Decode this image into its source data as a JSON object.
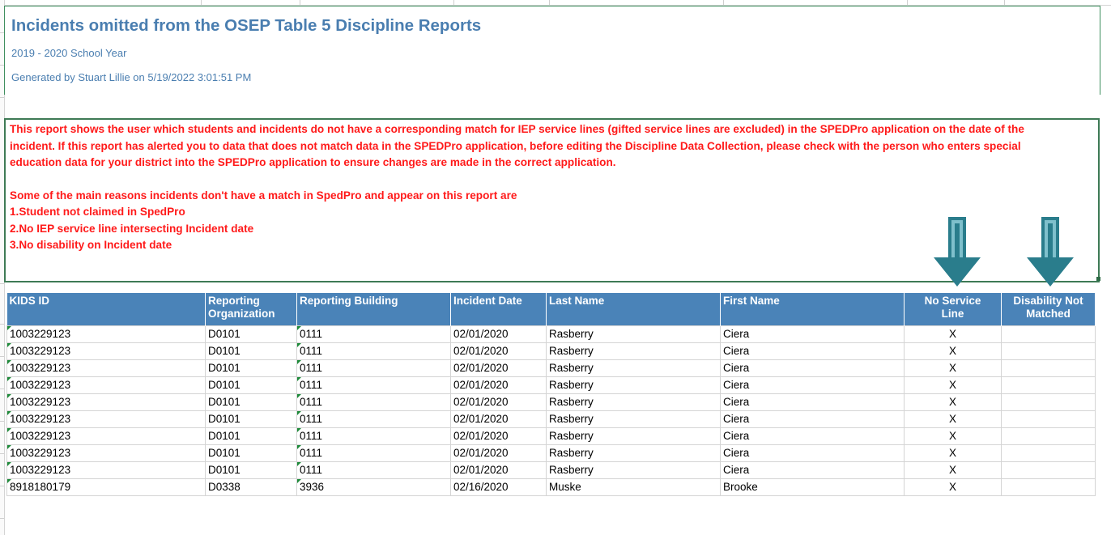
{
  "report": {
    "title": "Incidents omitted from the OSEP Table 5 Discipline Reports",
    "school_year": "2019 - 2020 School Year",
    "generated_by": "Generated by Stuart Lillie on 5/19/2022 3:01:51 PM"
  },
  "notice": {
    "paragraph": "This report shows the user which students and incidents do not have a corresponding match for IEP service lines (gifted service lines are excluded) in the SPEDPro application on the date of the incident. If this report has alerted you to data that does not match data in the SPEDPro application, before editing the Discipline Data Collection, please check with the person who enters special education data for your district into the SPEDPro application to ensure changes are made in the correct application.",
    "reasons_intro": "Some of the main reasons incidents don't have a match in SpedPro and appear on this report are",
    "reasons": [
      "1.Student not claimed in SpedPro",
      "2.No IEP service line intersecting Incident date",
      "3.No disability on Incident date"
    ]
  },
  "colors": {
    "title": "#4a7eb0",
    "notice_text": "#ff1a1a",
    "header_bg": "#4a83b8",
    "arrow": "#2a7d8c",
    "cell_flag": "#1e8a3a"
  },
  "table": {
    "headers": {
      "kids_id": "KIDS ID",
      "reporting_org_line1": "Reporting",
      "reporting_org_line2": "Organization",
      "reporting_building": "Reporting Building",
      "incident_date": "Incident Date",
      "last_name": "Last Name",
      "first_name": "First Name",
      "no_service_line1": "No Service",
      "no_service_line2": "Line",
      "disability_line1": "Disability Not",
      "disability_line2": "Matched"
    },
    "rows": [
      {
        "kids_id": "1003229123",
        "org": "D0101",
        "building": "0111",
        "date": "02/01/2020",
        "last": "Rasberry",
        "first": "Ciera",
        "no_service": "X",
        "disability": ""
      },
      {
        "kids_id": "1003229123",
        "org": "D0101",
        "building": "0111",
        "date": "02/01/2020",
        "last": "Rasberry",
        "first": "Ciera",
        "no_service": "X",
        "disability": ""
      },
      {
        "kids_id": "1003229123",
        "org": "D0101",
        "building": "0111",
        "date": "02/01/2020",
        "last": "Rasberry",
        "first": "Ciera",
        "no_service": "X",
        "disability": ""
      },
      {
        "kids_id": "1003229123",
        "org": "D0101",
        "building": "0111",
        "date": "02/01/2020",
        "last": "Rasberry",
        "first": "Ciera",
        "no_service": "X",
        "disability": ""
      },
      {
        "kids_id": "1003229123",
        "org": "D0101",
        "building": "0111",
        "date": "02/01/2020",
        "last": "Rasberry",
        "first": "Ciera",
        "no_service": "X",
        "disability": ""
      },
      {
        "kids_id": "1003229123",
        "org": "D0101",
        "building": "0111",
        "date": "02/01/2020",
        "last": "Rasberry",
        "first": "Ciera",
        "no_service": "X",
        "disability": ""
      },
      {
        "kids_id": "1003229123",
        "org": "D0101",
        "building": "0111",
        "date": "02/01/2020",
        "last": "Rasberry",
        "first": "Ciera",
        "no_service": "X",
        "disability": ""
      },
      {
        "kids_id": "1003229123",
        "org": "D0101",
        "building": "0111",
        "date": "02/01/2020",
        "last": "Rasberry",
        "first": "Ciera",
        "no_service": "X",
        "disability": ""
      },
      {
        "kids_id": "1003229123",
        "org": "D0101",
        "building": "0111",
        "date": "02/01/2020",
        "last": "Rasberry",
        "first": "Ciera",
        "no_service": "X",
        "disability": ""
      },
      {
        "kids_id": "8918180179",
        "org": "D0338",
        "building": "3936",
        "date": "02/16/2020",
        "last": "Muske",
        "first": "Brooke",
        "no_service": "X",
        "disability": ""
      }
    ]
  }
}
